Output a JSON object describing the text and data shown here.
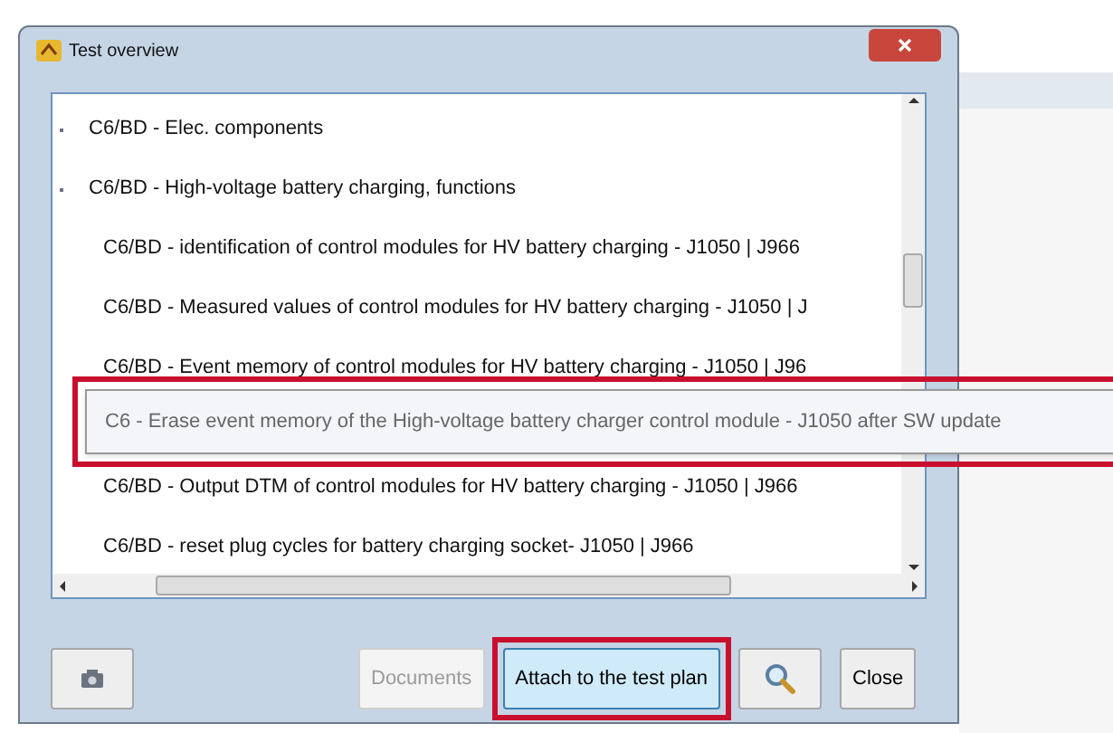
{
  "window": {
    "title": "Test overview"
  },
  "tree": [
    {
      "label": "C6/BD - Elec. components"
    },
    {
      "label": "C6/BD - High-voltage battery charging, functions",
      "children": [
        {
          "label": "C6/BD - identification of control modules for HV battery charging - J1050 | J966"
        },
        {
          "label": "C6/BD - Measured values of control modules for HV battery charging - J1050 | J"
        },
        {
          "label": "C6/BD - Event memory of control modules for HV battery charging - J1050 | J96"
        },
        {
          "label": "C6/BD - Output DTM of control modules for HV battery charging - J1050 | J966"
        },
        {
          "label": "C6/BD - reset plug cycles for battery charging socket- J1050 | J966"
        }
      ]
    }
  ],
  "tooltip": {
    "text": "C6 - Erase event memory of the High-voltage battery charger control module - J1050 after SW update",
    "highlighted": true
  },
  "buttons": [
    {
      "kind": "camera",
      "disabled": false,
      "highlighted": false
    },
    {
      "kind": "text",
      "label": "Documents",
      "disabled": true,
      "highlighted": false
    },
    {
      "kind": "text",
      "label": "Attach to the test plan",
      "disabled": false,
      "highlighted": true
    },
    {
      "kind": "search",
      "disabled": false,
      "highlighted": false
    },
    {
      "kind": "text",
      "label": "Close",
      "disabled": false,
      "highlighted": false
    }
  ]
}
